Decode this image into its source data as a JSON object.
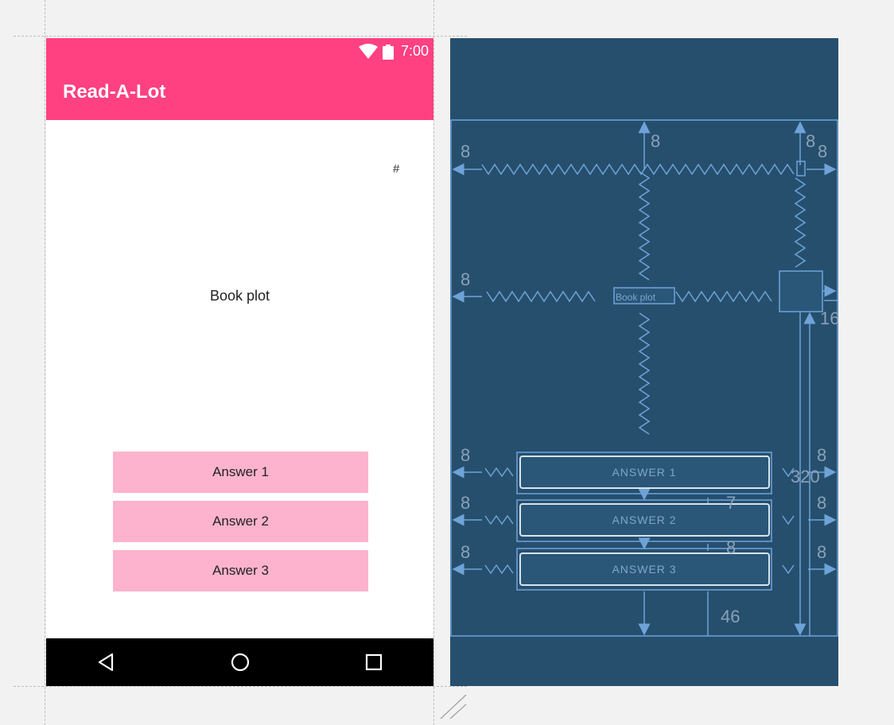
{
  "status_bar": {
    "time": "7:00",
    "wifi_icon": "wifi-icon",
    "battery_icon": "battery-icon"
  },
  "app_bar": {
    "title": "Read-A-Lot"
  },
  "content": {
    "hash_label": "#",
    "book_plot": "Book plot"
  },
  "answers": [
    {
      "label": "Answer 1"
    },
    {
      "label": "Answer 2"
    },
    {
      "label": "Answer 3"
    }
  ],
  "nav_bar": {
    "back_icon": "back-icon",
    "home_icon": "home-icon",
    "recents_icon": "recents-icon"
  },
  "blueprint": {
    "margins": {
      "top_center": "8",
      "top_right": "8",
      "left_row1": "8",
      "right_row1": "8",
      "left_book": "8",
      "right_16": "16",
      "left_a1": "8",
      "left_a2": "8",
      "left_a3": "8",
      "right_a1": "8",
      "right_a2": "8",
      "right_a3": "8",
      "side_320": "320",
      "gap_7": "7",
      "gap_8": "8",
      "bottom_46": "46"
    },
    "book_plot": "Book plot",
    "answers": [
      "ANSWER 1",
      "ANSWER 2",
      "ANSWER 3"
    ]
  },
  "colors": {
    "accent": "#ff4081",
    "button": "#fdb3cd",
    "blueprint_bg": "#264f6e",
    "blueprint_line": "#6fa3d8"
  }
}
